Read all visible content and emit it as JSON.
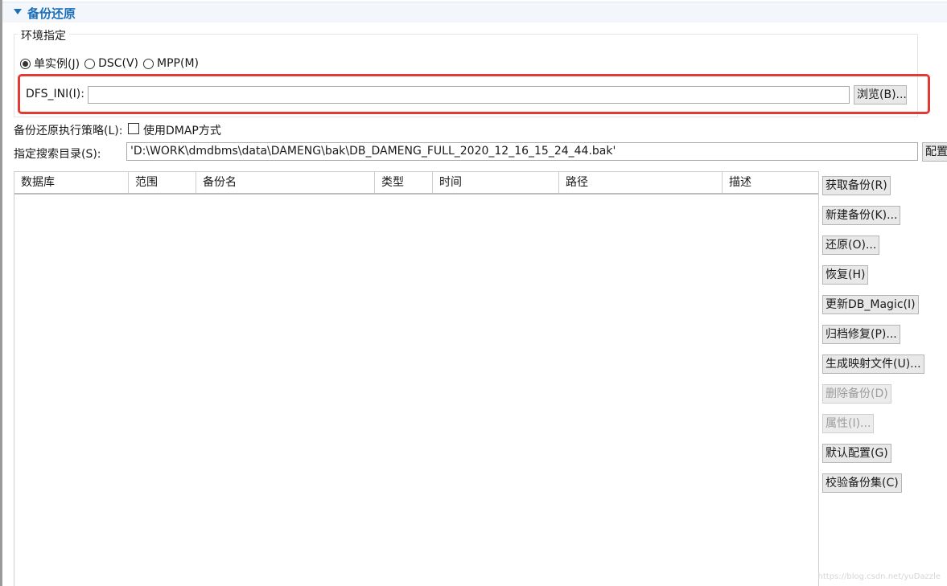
{
  "section": {
    "title": "备份还原"
  },
  "env": {
    "legend": "环境指定",
    "radios": [
      {
        "label": "单实例(J)",
        "checked": true
      },
      {
        "label": "DSC(V)",
        "checked": false
      },
      {
        "label": "MPP(M)",
        "checked": false
      }
    ],
    "dfs_label": "DFS_INI(I):",
    "dfs_value": "",
    "browse_label": "浏览(B)..."
  },
  "policy": {
    "label": "备份还原执行策略(L):",
    "dmap_label": "使用DMAP方式",
    "dmap_checked": false
  },
  "search_dir": {
    "label": "指定搜索目录(S):",
    "value": "'D:\\WORK\\dmdbms\\data\\DAMENG\\bak\\DB_DAMENG_FULL_2020_12_16_15_24_44.bak'",
    "config_label": "配置"
  },
  "table": {
    "columns": [
      "数据库",
      "范围",
      "备份名",
      "类型",
      "时间",
      "路径",
      "描述"
    ],
    "rows": []
  },
  "actions": [
    {
      "label": "获取备份(R)",
      "enabled": true
    },
    {
      "label": "新建备份(K)...",
      "enabled": true
    },
    {
      "label": "还原(O)...",
      "enabled": true
    },
    {
      "label": "恢复(H)",
      "enabled": true
    },
    {
      "label": "更新DB_Magic(I)",
      "enabled": true
    },
    {
      "label": "归档修复(P)...",
      "enabled": true
    },
    {
      "label": "生成映射文件(U)...",
      "enabled": true
    },
    {
      "label": "删除备份(D)",
      "enabled": false
    },
    {
      "label": "属性(I)...",
      "enabled": false
    },
    {
      "label": "默认配置(G)",
      "enabled": true
    },
    {
      "label": "校验备份集(C)",
      "enabled": true
    }
  ],
  "watermark": "https://blog.csdn.net/yuDazzle",
  "colors": {
    "accent": "#1d6fb9",
    "highlight": "#e53935"
  }
}
